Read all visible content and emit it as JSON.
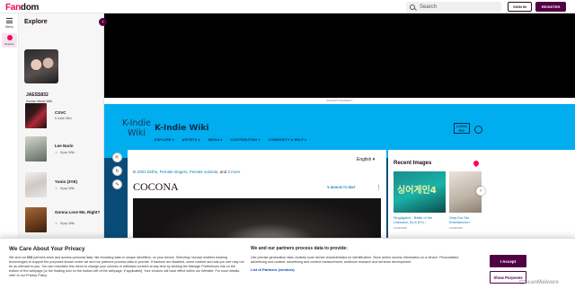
{
  "topbar": {
    "logo_part1": "Fan",
    "logo_part2": "dom",
    "search_placeholder": "Search",
    "signin_label": "SIGN IN",
    "register_label": "REGISTER"
  },
  "left_nav": {
    "menu_label": "Menu",
    "explore_label": "Explore"
  },
  "explore": {
    "title": "Explore",
    "featured": {
      "name": "JAESS832",
      "sub": "Korean Music Wiki"
    },
    "items": [
      {
        "name": "CSVC",
        "sub": "K-Indie Wiki"
      },
      {
        "name": "Lee Narin",
        "sub": "Kpop Wiki"
      },
      {
        "name": "Yunin (3YE)",
        "sub": "Kpop Wiki"
      },
      {
        "name": "Gonna Love Me, Right?",
        "sub": "Kpop Wiki"
      }
    ]
  },
  "ad": {
    "label": "ADVERTISEMENT"
  },
  "wiki": {
    "wordmark_line1": "K-Indie",
    "wordmark_line2": "Wiki",
    "name": "K-Indie Wiki",
    "nav": [
      "EXPLORE",
      "ARTISTS",
      "MEDIA",
      "CONTRIBUTING",
      "COMMUNITY & HELP"
    ],
    "badge": "LOGO PIC"
  },
  "article": {
    "language": "English",
    "categories_prefix": "in",
    "categories": [
      "2001 births",
      "Female singers",
      "Female soloists"
    ],
    "categories_more": "3 more",
    "title": "COCONA",
    "edit_label": "SIGN IN TO EDIT"
  },
  "rail": {
    "title": "Recent Images",
    "image1_text": "싱어게인4",
    "items": [
      {
        "caption": "SingAgain4 - Battle of the Unknown, Ep.6 (Fro...",
        "date": "11/26/2025"
      },
      {
        "caption": "Gray Dot Stu Entertainmen",
        "date": "11/26/2025"
      }
    ]
  },
  "consent": {
    "left_title": "We Care About Your Privacy",
    "left_p1": "We and our ",
    "left_count": "633",
    "left_p2": " partners store and access personal data, like browsing data or unique identifiers, on your device. Selecting I Accept enables tracking technologies to support the purposes shown under we and our partners process data to provide. If trackers are disabled, some content and ads you see may not be as relevant to you. You can resurface this menu to change your choices or withdraw consent at any time by clicking the Manage Preferences link on the bottom of the webpage [or the floating icon on the bottom-left of the webpage, if applicable]. Your choices will have effect within our Website. For more details, refer to our Privacy Policy.",
    "mid_title": "We and our partners process data to provide:",
    "mid_p": "Use precise geolocation data. Actively scan device characteristics for identification. Store and/or access information on a device. Personalised advertising and content, advertising and content measurement, audience research and services development.",
    "partners_link": "List of Partners (vendors)",
    "accept_label": "I Accept",
    "show_purposes_label": "Show Purposes"
  },
  "watermark": "ScanMalware"
}
